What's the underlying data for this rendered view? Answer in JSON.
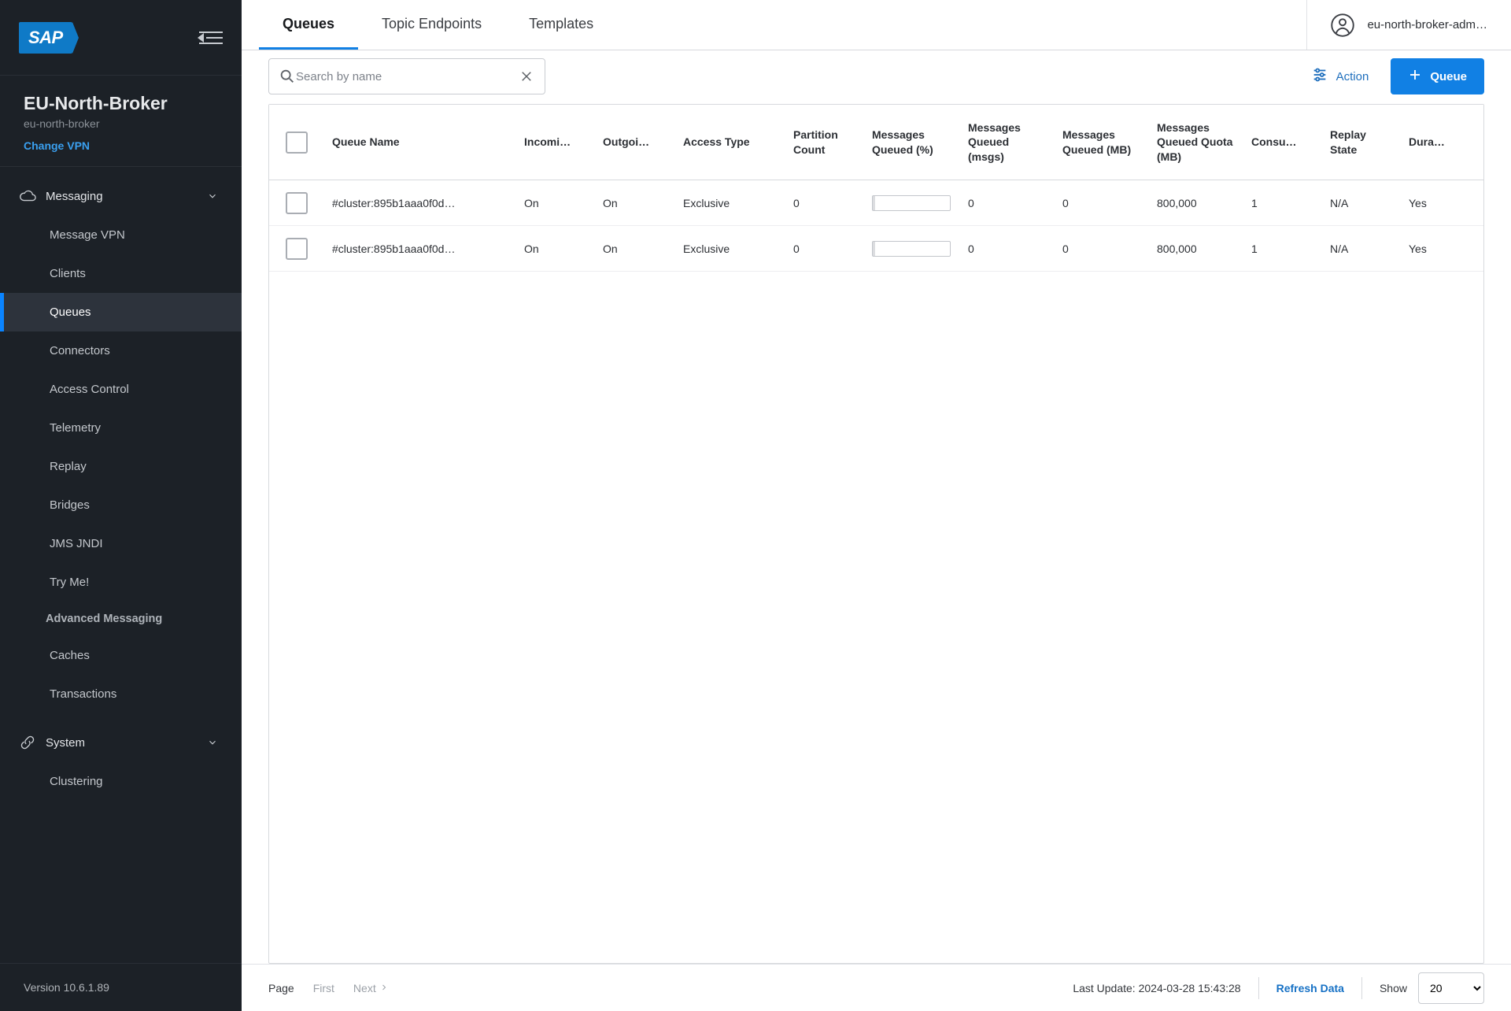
{
  "sidebar": {
    "logo_text": "SAP",
    "broker_title": "EU-North-Broker",
    "broker_sub": "eu-north-broker",
    "change_vpn": "Change VPN",
    "sections": {
      "messaging": {
        "label": "Messaging"
      },
      "system": {
        "label": "System"
      }
    },
    "items": {
      "message_vpn": "Message VPN",
      "clients": "Clients",
      "queues": "Queues",
      "connectors": "Connectors",
      "access_control": "Access Control",
      "telemetry": "Telemetry",
      "replay": "Replay",
      "bridges": "Bridges",
      "jms_jndi": "JMS JNDI",
      "try_me": "Try Me!",
      "adv_msg": "Advanced Messaging",
      "caches": "Caches",
      "transactions": "Transactions",
      "clustering": "Clustering"
    },
    "version": "Version 10.6.1.89"
  },
  "topbar": {
    "tabs": {
      "queues": "Queues",
      "topic_endpoints": "Topic Endpoints",
      "templates": "Templates"
    },
    "user": "eu-north-broker-adm…"
  },
  "toolbar": {
    "search_placeholder": "Search by name",
    "action": "Action",
    "queue_btn": "Queue"
  },
  "table": {
    "headers": {
      "name": "Queue Name",
      "incoming": "Incomi…",
      "outgoing": "Outgoi…",
      "access_type": "Access Type",
      "partition_count": "Partition Count",
      "queued_pct": "Messages Queued (%)",
      "queued_msgs": "Messages Queued (msgs)",
      "queued_mb": "Messages Queued (MB)",
      "quota_mb": "Messages Queued Quota (MB)",
      "consumers": "Consu…",
      "replay_state": "Replay State",
      "durable": "Dura…"
    },
    "rows": [
      {
        "name": "#cluster:895b1aaa0f0d…",
        "incoming": "On",
        "outgoing": "On",
        "access_type": "Exclusive",
        "partition_count": "0",
        "queued_msgs": "0",
        "queued_mb": "0",
        "quota_mb": "800,000",
        "consumers": "1",
        "replay_state": "N/A",
        "durable": "Yes"
      },
      {
        "name": "#cluster:895b1aaa0f0d…",
        "incoming": "On",
        "outgoing": "On",
        "access_type": "Exclusive",
        "partition_count": "0",
        "queued_msgs": "0",
        "queued_mb": "0",
        "quota_mb": "800,000",
        "consumers": "1",
        "replay_state": "N/A",
        "durable": "Yes"
      }
    ]
  },
  "footer": {
    "page_label": "Page",
    "first": "First",
    "next": "Next",
    "last_update": "Last Update: 2024-03-28 15:43:28",
    "refresh": "Refresh Data",
    "show": "Show",
    "show_value": "20"
  }
}
